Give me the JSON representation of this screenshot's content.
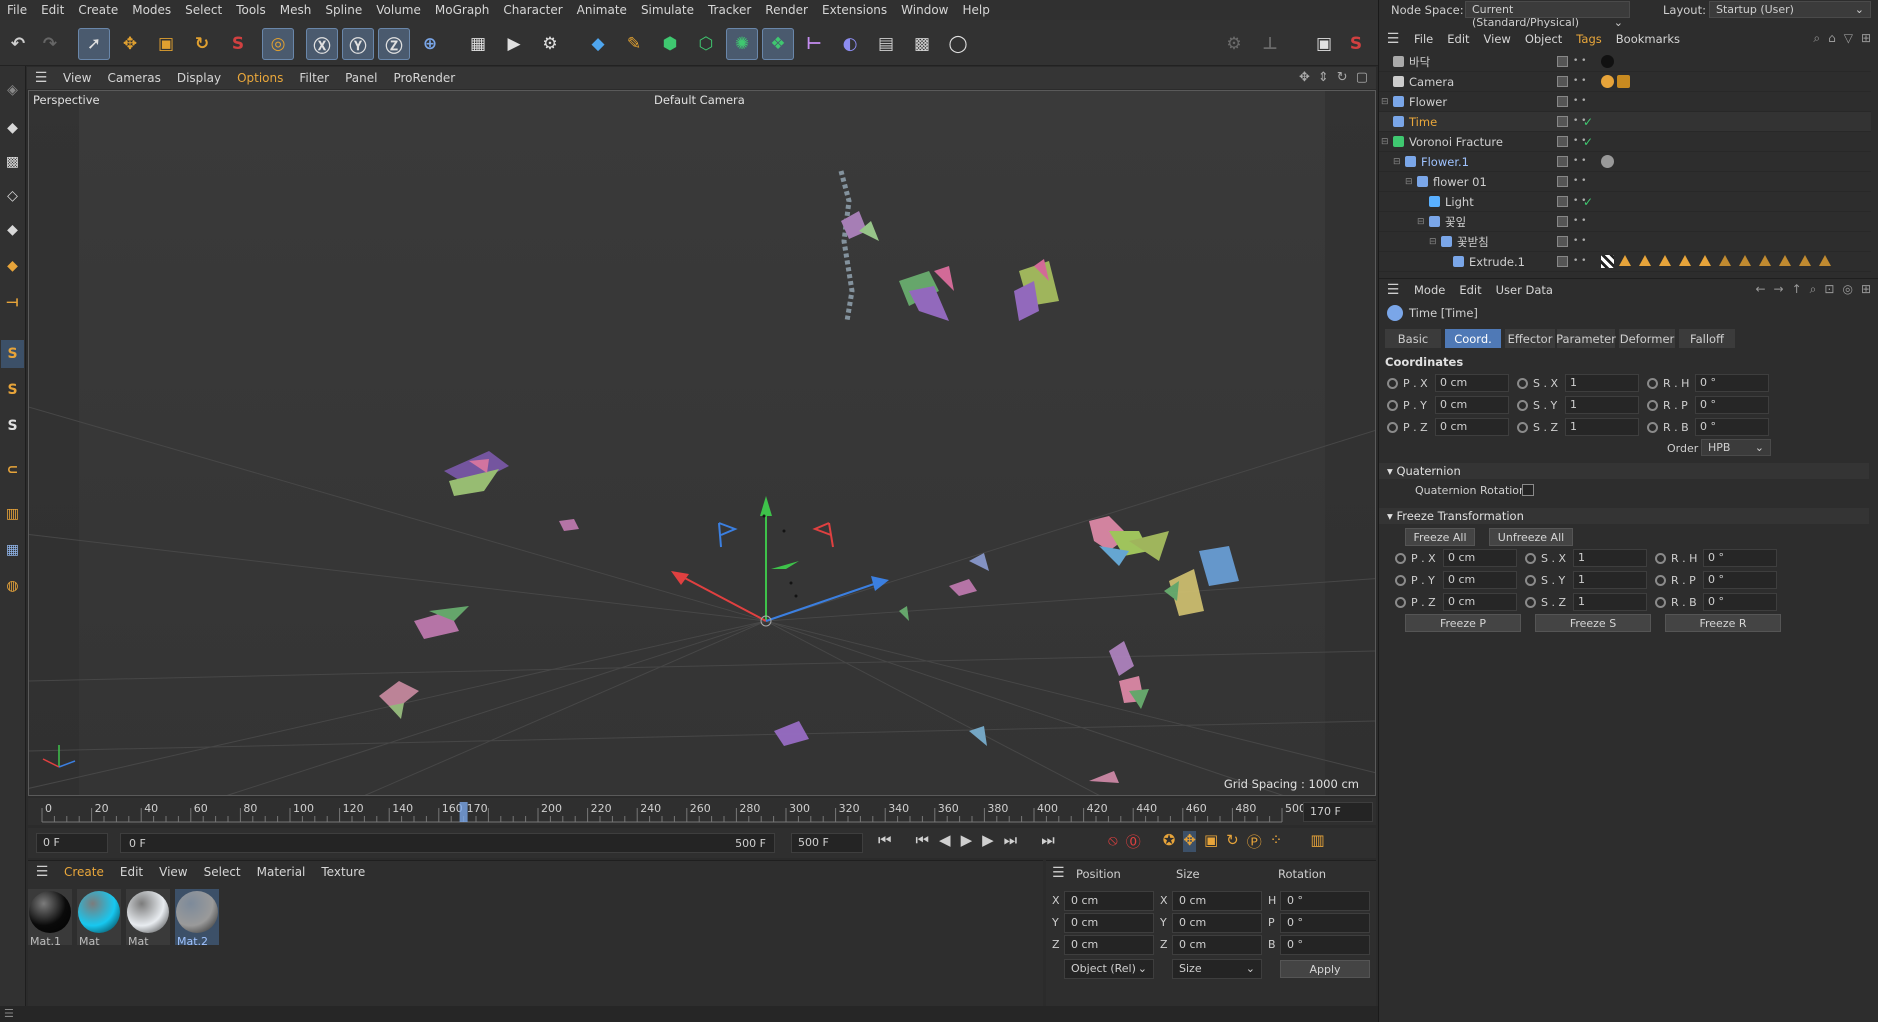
{
  "menu": [
    "File",
    "Edit",
    "Create",
    "Modes",
    "Select",
    "Tools",
    "Mesh",
    "Spline",
    "Volume",
    "MoGraph",
    "Character",
    "Animate",
    "Simulate",
    "Tracker",
    "Render",
    "Extensions",
    "Window",
    "Help"
  ],
  "node_space": {
    "label": "Node Space:",
    "value": "Current (Standard/Physical)"
  },
  "layout": {
    "label": "Layout:",
    "value": "Startup (User)"
  },
  "viewport": {
    "menu": [
      "View",
      "Cameras",
      "Display",
      "Options",
      "Filter",
      "Panel",
      "ProRender"
    ],
    "active_menu": "Options",
    "label": "Perspective",
    "camera": "Default Camera",
    "grid_spacing": "Grid Spacing : 1000 cm"
  },
  "toolbar_icons": [
    "undo-icon",
    "redo-icon",
    "live-select-icon",
    "move-icon",
    "scale-icon",
    "rotate-icon",
    "recent-tool-icon",
    "transform-icon",
    "x-axis-icon",
    "y-axis-icon",
    "z-axis-icon",
    "world-coords-icon",
    "render-region-icon",
    "render-view-icon",
    "render-settings-icon",
    "cube-icon",
    "pen-icon",
    "subdivision-icon",
    "extrude-icon",
    "cloner-icon",
    "mograph-icon",
    "deformer-icon",
    "field-icon",
    "floor-icon",
    "camera-icon",
    "light-icon"
  ],
  "timeline": {
    "ticks": [
      "0",
      "20",
      "40",
      "60",
      "80",
      "100",
      "120",
      "140",
      "160",
      "170",
      "200",
      "220",
      "240",
      "260",
      "280",
      "300",
      "320",
      "340",
      "360",
      "380",
      "400",
      "420",
      "440",
      "460",
      "480",
      "500"
    ],
    "current": 170,
    "max": 500,
    "current_label": "170 F"
  },
  "transport": {
    "start": "0 F",
    "range_start": "0 F",
    "range_end": "500 F",
    "end": "500 F"
  },
  "material_menu": [
    "Create",
    "Edit",
    "View",
    "Select",
    "Material",
    "Texture"
  ],
  "materials": [
    {
      "name": "Mat.1",
      "color": "#0a0a0a"
    },
    {
      "name": "Mat",
      "color": "#17c8f0"
    },
    {
      "name": "Mat",
      "color": "#e8ecf0"
    },
    {
      "name": "Mat.2",
      "color": "#9a9a9a"
    }
  ],
  "coord_manager": {
    "headers": [
      "Position",
      "Size",
      "Rotation"
    ],
    "rows": [
      {
        "axis": "X",
        "pos": "0 cm",
        "saxis": "X",
        "size": "0 cm",
        "raxis": "H",
        "rot": "0 °"
      },
      {
        "axis": "Y",
        "pos": "0 cm",
        "saxis": "Y",
        "size": "0 cm",
        "raxis": "P",
        "rot": "0 °"
      },
      {
        "axis": "Z",
        "pos": "0 cm",
        "saxis": "Z",
        "size": "0 cm",
        "raxis": "B",
        "rot": "0 °"
      }
    ],
    "mode": "Object (Rel)",
    "size_mode": "Size",
    "apply": "Apply"
  },
  "object_manager": {
    "menu": [
      "File",
      "Edit",
      "View",
      "Object",
      "Tags",
      "Bookmarks"
    ],
    "objects": [
      {
        "name": "바닥",
        "indent": 1
      },
      {
        "name": "Camera",
        "indent": 1
      },
      {
        "name": "Flower",
        "indent": 1
      },
      {
        "name": "Time",
        "indent": 1
      },
      {
        "name": "Voronoi Fracture",
        "indent": 1
      },
      {
        "name": "Flower.1",
        "indent": 2
      },
      {
        "name": "flower 01",
        "indent": 3
      },
      {
        "name": "Light",
        "indent": 4
      },
      {
        "name": "꽃잎",
        "indent": 4
      },
      {
        "name": "꽃받침",
        "indent": 5
      },
      {
        "name": "Extrude.1",
        "indent": 6
      }
    ]
  },
  "attributes": {
    "menu": [
      "Mode",
      "Edit",
      "User Data"
    ],
    "title": "Time [Time]",
    "tabs": [
      "Basic",
      "Coord.",
      "Effector",
      "Parameter",
      "Deformer",
      "Falloff"
    ],
    "active_tab": "Coord.",
    "coordinates_title": "Coordinates",
    "coords": [
      {
        "p": "P . X",
        "pv": "0 cm",
        "s": "S . X",
        "sv": "1",
        "r": "R . H",
        "rv": "0 °"
      },
      {
        "p": "P . Y",
        "pv": "0 cm",
        "s": "S . Y",
        "sv": "1",
        "r": "R . P",
        "rv": "0 °"
      },
      {
        "p": "P . Z",
        "pv": "0 cm",
        "s": "S . Z",
        "sv": "1",
        "r": "R . B",
        "rv": "0 °"
      }
    ],
    "order_label": "Order",
    "order_value": "HPB",
    "quaternion_title": "Quaternion",
    "quaternion_rotation": "Quaternion Rotation",
    "freeze_title": "Freeze Transformation",
    "freeze_all": "Freeze All",
    "unfreeze_all": "Unfreeze All",
    "freeze_coords": [
      {
        "p": "P . X",
        "pv": "0 cm",
        "s": "S . X",
        "sv": "1",
        "r": "R . H",
        "rv": "0 °"
      },
      {
        "p": "P . Y",
        "pv": "0 cm",
        "s": "S . Y",
        "sv": "1",
        "r": "R . P",
        "rv": "0 °"
      },
      {
        "p": "P . Z",
        "pv": "0 cm",
        "s": "S . Z",
        "sv": "1",
        "r": "R . B",
        "rv": "0 °"
      }
    ],
    "freeze_p": "Freeze P",
    "freeze_s": "Freeze S",
    "freeze_r": "Freeze R"
  },
  "colors": {
    "accent": "#4f79b6",
    "highlight": "#e9a73b",
    "viewport_bg": "#3a3a3a"
  }
}
